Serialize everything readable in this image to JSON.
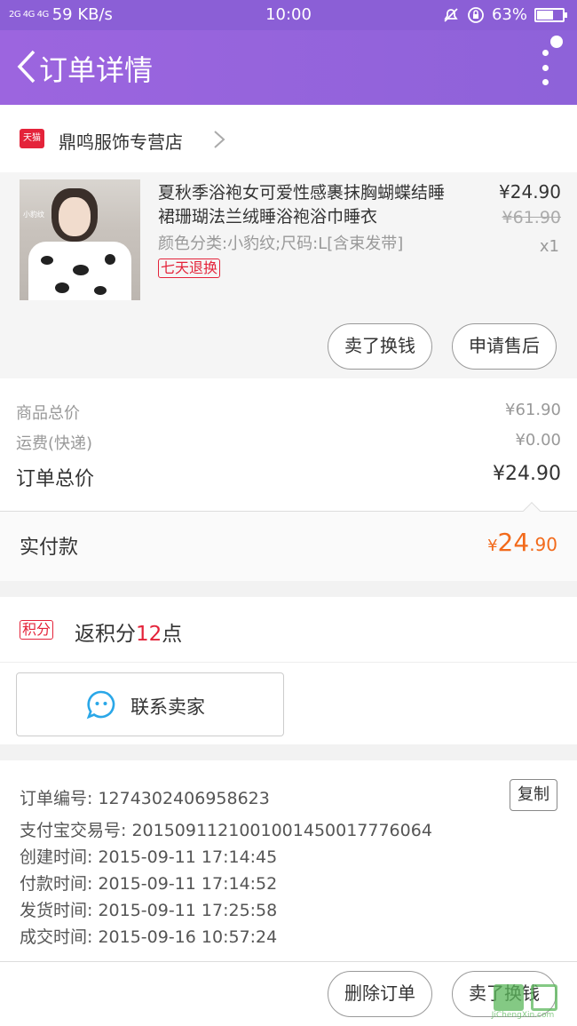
{
  "status_bar": {
    "signal": "2G 4G 4G",
    "speed": "59 KB/s",
    "time": "10:00",
    "battery": "63%",
    "battery_level": 0.63
  },
  "header": {
    "title": "订单详情"
  },
  "shop": {
    "badge": "天猫",
    "name": "鼎鸣服饰专营店"
  },
  "item": {
    "title": "夏秋季浴袍女可爱性感裹抹胸蝴蝶结睡裙珊瑚法兰绒睡浴袍浴巾睡衣",
    "spec": "颜色分类:小豹纹;尺码:L[含束发带]",
    "badge": "七天退换",
    "price": "¥24.90",
    "original_price": "¥61.90",
    "quantity": "x1",
    "image_caption": "小豹纹",
    "sell_button": "卖了换钱",
    "after_sale_button": "申请售后"
  },
  "totals": {
    "goods_label": "商品总价",
    "goods_value": "¥61.90",
    "shipping_label": "运费(快递)",
    "shipping_value": "¥0.00",
    "order_label": "订单总价",
    "order_value": "¥24.90"
  },
  "paid": {
    "label": "实付款",
    "currency": "¥",
    "integer": "24",
    "decimal": ".90"
  },
  "points": {
    "tag": "积分",
    "prefix": "返积分",
    "count": "12",
    "suffix": "点"
  },
  "contact": {
    "label": "联系卖家"
  },
  "info": {
    "order_no": "订单编号: 1274302406958623",
    "alipay_no": "支付宝交易号: 2015091121001001450017776064",
    "created": "创建时间: 2015-09-11 17:14:45",
    "paid": "付款时间: 2015-09-11 17:14:52",
    "shipped": "发货时间: 2015-09-11 17:25:58",
    "completed": "成交时间: 2015-09-16 10:57:24",
    "copy_button": "复制"
  },
  "bottom": {
    "delete_button": "删除订单",
    "sell_button": "卖了换钱"
  },
  "watermark": {
    "url": "JiChengXin.com"
  },
  "colors": {
    "header": "#9c65df",
    "accent_red": "#e4233a",
    "paid_orange": "#f26a1b"
  }
}
